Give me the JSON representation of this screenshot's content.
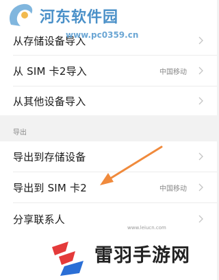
{
  "watermark_top": {
    "site_name": "河东软件园",
    "url": "www.pc0359.cn"
  },
  "import_section": {
    "items": [
      {
        "label": "从存储设备导入",
        "value": ""
      },
      {
        "label": "从 SIM 卡2导入",
        "value": "中国移动"
      },
      {
        "label": "从其他设备导入",
        "value": ""
      }
    ]
  },
  "export_section": {
    "title": "导出",
    "items": [
      {
        "label": "导出到存储设备",
        "value": ""
      },
      {
        "label": "导出到 SIM 卡2",
        "value": "中国移动"
      },
      {
        "label": "分享联系人",
        "value": ""
      }
    ]
  },
  "watermark_bottom": {
    "site_name": "雷羽手游网",
    "url": "www.leiucn.com"
  },
  "colors": {
    "arrow": "#f08a3c",
    "top_logo": "#4a90c8",
    "bottom_logo_red": "#e43a3a",
    "bottom_logo_blue": "#2b6fd6"
  }
}
